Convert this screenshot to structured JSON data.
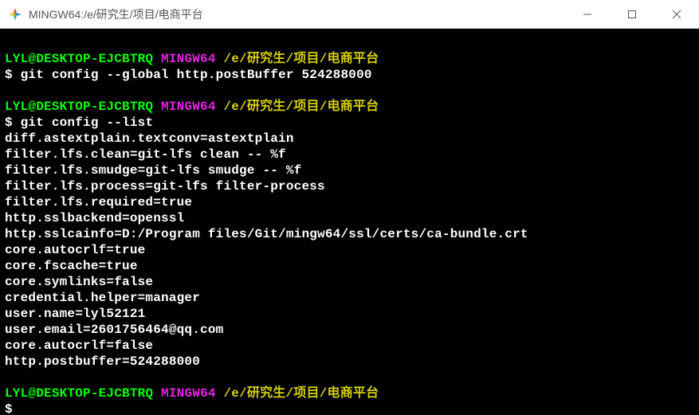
{
  "titlebar": {
    "title": "MINGW64:/e/研究生/项目/电商平台"
  },
  "prompt": {
    "user_host": "LYL@DESKTOP-EJCBTRQ",
    "shell": "MINGW64",
    "path": "/e/研究生/项目/电商平台",
    "symbol": "$"
  },
  "blocks": [
    {
      "command": "git config --global http.postBuffer 524288000",
      "output": []
    },
    {
      "command": "git config --list",
      "output": [
        "diff.astextplain.textconv=astextplain",
        "filter.lfs.clean=git-lfs clean -- %f",
        "filter.lfs.smudge=git-lfs smudge -- %f",
        "filter.lfs.process=git-lfs filter-process",
        "filter.lfs.required=true",
        "http.sslbackend=openssl",
        "http.sslcainfo=D:/Program files/Git/mingw64/ssl/certs/ca-bundle.crt",
        "core.autocrlf=true",
        "core.fscache=true",
        "core.symlinks=false",
        "credential.helper=manager",
        "user.name=lyl52121",
        "user.email=2601756464@qq.com",
        "core.autocrlf=false",
        "http.postbuffer=524288000"
      ]
    },
    {
      "command": "",
      "output": []
    }
  ]
}
